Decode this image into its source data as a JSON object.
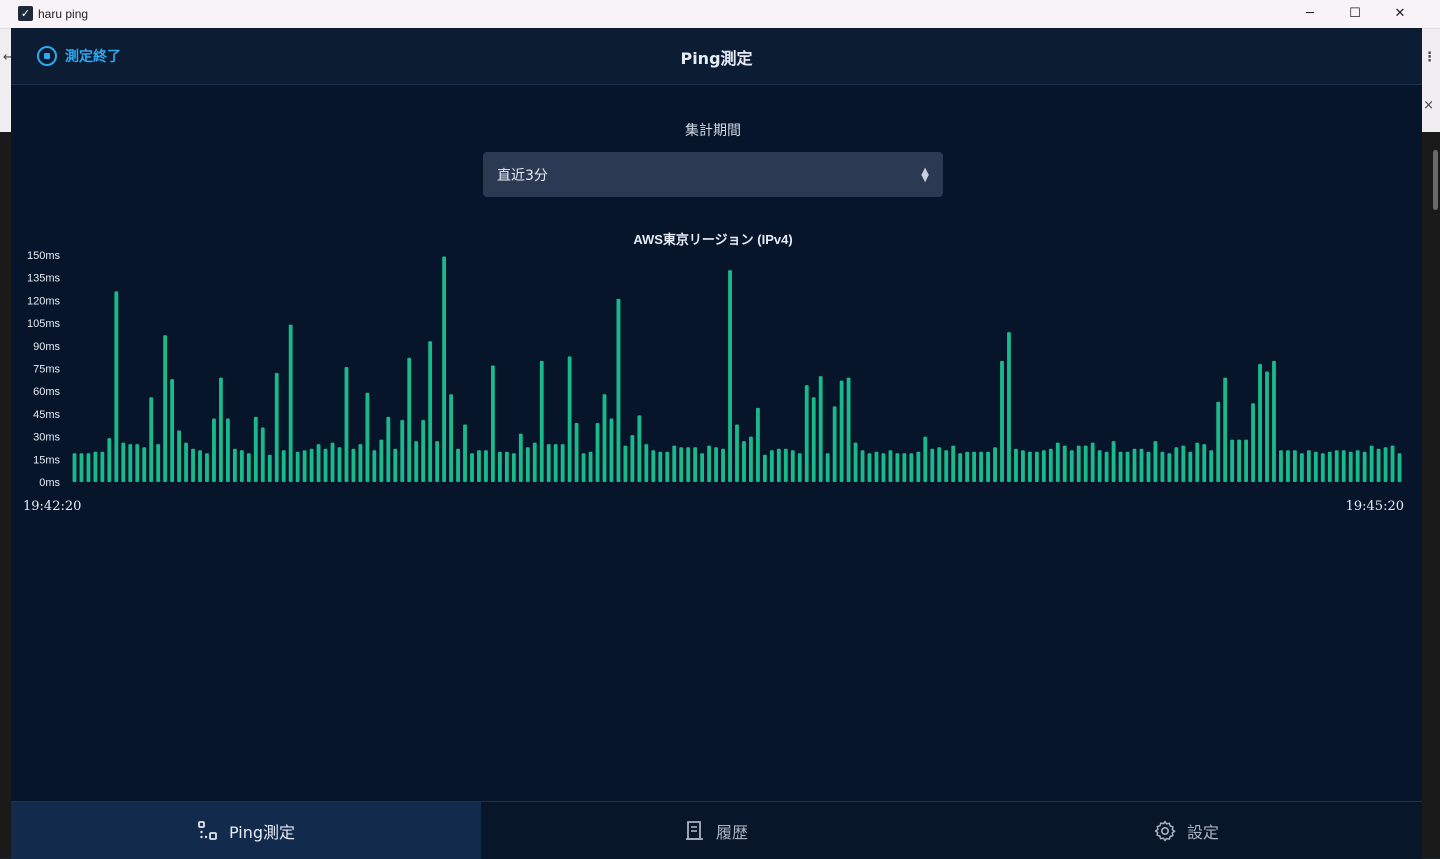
{
  "window": {
    "title": "haru ping",
    "minimize_glyph": "─",
    "maximize_glyph": "☐",
    "close_glyph": "✕"
  },
  "header": {
    "stop_label": "測定終了",
    "title": "Ping測定"
  },
  "period": {
    "label": "集計期間",
    "selected": "直近3分"
  },
  "chart_data": {
    "type": "bar",
    "title": "AWS東京リージョン (IPv4)",
    "y_ticks": [
      "150ms",
      "135ms",
      "120ms",
      "105ms",
      "90ms",
      "75ms",
      "60ms",
      "45ms",
      "30ms",
      "15ms",
      "0ms"
    ],
    "ylim": [
      0,
      150
    ],
    "x_start_label": "19:42:20",
    "x_end_label": "19:45:20",
    "bar_color": "#19b98a",
    "values": [
      19,
      19,
      19,
      20,
      20,
      29,
      126,
      26,
      25,
      25,
      23,
      56,
      25,
      97,
      68,
      34,
      26,
      22,
      21,
      19,
      42,
      69,
      42,
      22,
      21,
      19,
      43,
      36,
      18,
      72,
      21,
      104,
      20,
      21,
      22,
      25,
      22,
      26,
      23,
      76,
      22,
      25,
      59,
      21,
      28,
      43,
      22,
      41,
      82,
      27,
      41,
      93,
      27,
      149,
      58,
      22,
      38,
      19,
      21,
      21,
      77,
      20,
      20,
      19,
      32,
      23,
      26,
      80,
      25,
      25,
      25,
      83,
      39,
      19,
      20,
      39,
      58,
      42,
      121,
      24,
      31,
      44,
      25,
      21,
      20,
      20,
      24,
      23,
      23,
      23,
      19,
      24,
      23,
      22,
      140,
      38,
      27,
      30,
      49,
      18,
      21,
      22,
      22,
      21,
      19,
      64,
      56,
      70,
      19,
      50,
      67,
      69,
      26,
      21,
      19,
      20,
      19,
      21,
      19,
      19,
      19,
      20,
      30,
      22,
      23,
      21,
      24,
      19,
      20,
      20,
      20,
      20,
      23,
      80,
      99,
      22,
      21,
      20,
      20,
      21,
      22,
      26,
      24,
      21,
      24,
      24,
      26,
      21,
      20,
      27,
      20,
      20,
      22,
      22,
      20,
      27,
      20,
      19,
      23,
      24,
      20,
      26,
      25,
      21,
      53,
      69,
      28,
      28,
      28,
      52,
      78,
      73,
      80,
      21,
      21,
      21,
      19,
      21,
      20,
      19,
      20,
      21,
      21,
      20,
      21,
      20,
      24,
      22,
      23,
      24,
      19
    ]
  },
  "nav": {
    "items": [
      {
        "label": "Ping測定",
        "icon": "ping-nodes-icon",
        "active": true
      },
      {
        "label": "履歴",
        "icon": "history-list-icon",
        "active": false
      },
      {
        "label": "設定",
        "icon": "gear-icon",
        "active": false
      }
    ]
  },
  "colors": {
    "background": "#06152a",
    "header": "#0b1c33",
    "accent": "#2ea8ee",
    "bar": "#19b98a",
    "nav_active": "#122a4b"
  }
}
